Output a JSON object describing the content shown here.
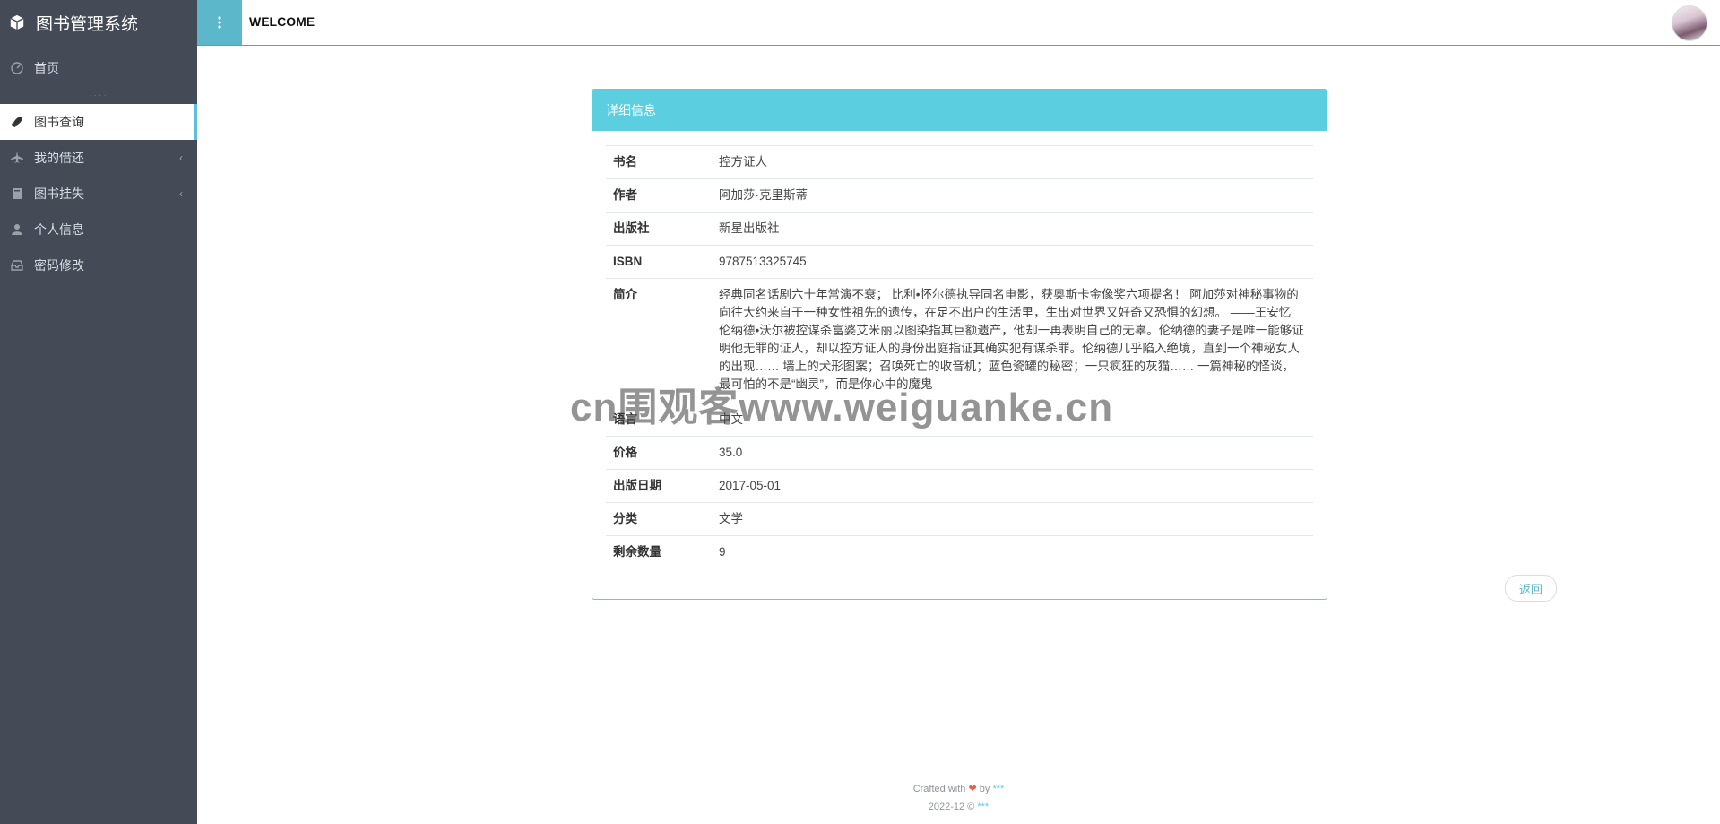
{
  "app": {
    "title": "图书管理系统"
  },
  "topbar": {
    "welcome": "WELCOME"
  },
  "sidebar": {
    "items": [
      {
        "label": "首页",
        "icon": "dashboard-icon"
      },
      {
        "label": "图书查询",
        "icon": "rocket-icon",
        "active": true
      },
      {
        "label": "我的借还",
        "icon": "plane-icon",
        "has_submenu": true
      },
      {
        "label": "图书挂失",
        "icon": "book-icon",
        "has_submenu": true
      },
      {
        "label": "个人信息",
        "icon": "user-icon"
      },
      {
        "label": "密码修改",
        "icon": "inbox-icon"
      }
    ]
  },
  "panel": {
    "title": "详细信息",
    "rows": [
      {
        "label": "书名",
        "value": "控方证人"
      },
      {
        "label": "作者",
        "value": "阿加莎·克里斯蒂"
      },
      {
        "label": "出版社",
        "value": "新星出版社"
      },
      {
        "label": "ISBN",
        "value": "9787513325745"
      },
      {
        "label": "简介",
        "value": "经典同名话剧六十年常演不衰； 比利•怀尔德执导同名电影，获奥斯卡金像奖六项提名！ 阿加莎对神秘事物的向往大约来自于一种女性祖先的遗传，在足不出户的生活里，生出对世界又好奇又恐惧的幻想。 ——王安忆 伦纳德•沃尔被控谋杀富婆艾米丽以图染指其巨额遗产，他却一再表明自己的无辜。伦纳德的妻子是唯一能够证明他无罪的证人，却以控方证人的身份出庭指证其确实犯有谋杀罪。伦纳德几乎陷入绝境，直到一个神秘女人的出现…… 墙上的犬形图案；召唤死亡的收音机；蓝色瓷罐的秘密；一只疯狂的灰猫…… 一篇神秘的怪谈，最可怕的不是“幽灵”，而是你心中的魔鬼"
      },
      {
        "label": "语言",
        "value": "中文"
      },
      {
        "label": "价格",
        "value": "35.0"
      },
      {
        "label": "出版日期",
        "value": "2017-05-01"
      },
      {
        "label": "分类",
        "value": "文学"
      },
      {
        "label": "剩余数量",
        "value": "9"
      }
    ]
  },
  "back_button": {
    "label": "返回"
  },
  "footer": {
    "crafted_prefix": "Crafted with",
    "crafted_by": "by",
    "crafted_author": "***",
    "copyright_prefix": "2022-12 ©",
    "copyright_owner": "***"
  },
  "watermark": "cn围观客www.weiguanke.cn",
  "colors": {
    "sidebar": "#444b57",
    "accent": "#5bcfe0",
    "menu_button": "#5bb7c9"
  }
}
